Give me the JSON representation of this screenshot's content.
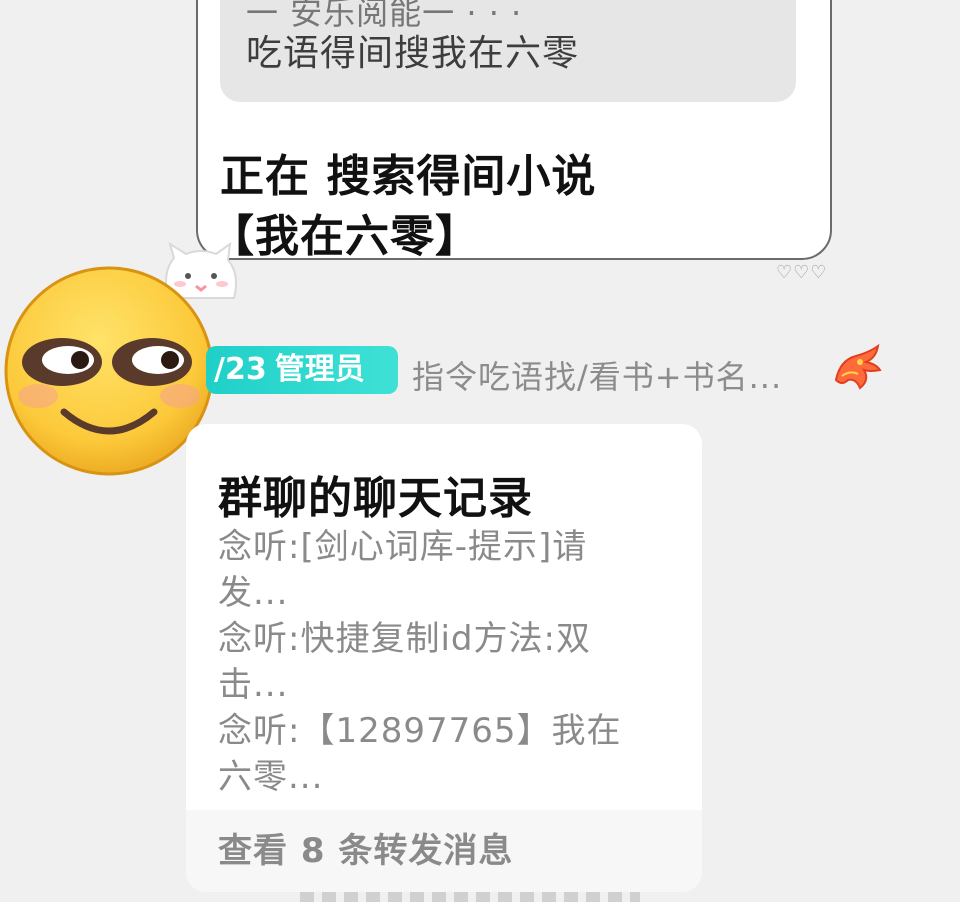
{
  "upper_message": {
    "quote_clipped": "一 安乐阅能一 ·   ·            ·",
    "quote_text": "吃语得间搜我在六零",
    "body_line1": "正在 搜索得间小说",
    "body_line2": "【我在六零】",
    "reactions": "♡♡♡"
  },
  "sender": {
    "level": "/23",
    "role": "管理员",
    "nickname": "指令吃语找/看书+书名..."
  },
  "forward_card": {
    "title": "群聊的聊天记录",
    "lines": [
      "念听:[剑心词库-提示]请发...",
      "念听:快捷复制id方法:双击...",
      "念听:【12897765】我在六零..."
    ],
    "footer": "查看 8 条转发消息"
  },
  "colors": {
    "background": "#f0f0f0",
    "badge": "#1fd0c8",
    "muted_text": "#8a8a8a"
  },
  "icons": {
    "avatar": "smirk-emoji-icon",
    "sticker": "cat-sticker-icon",
    "title_badge": "dragon-icon"
  }
}
